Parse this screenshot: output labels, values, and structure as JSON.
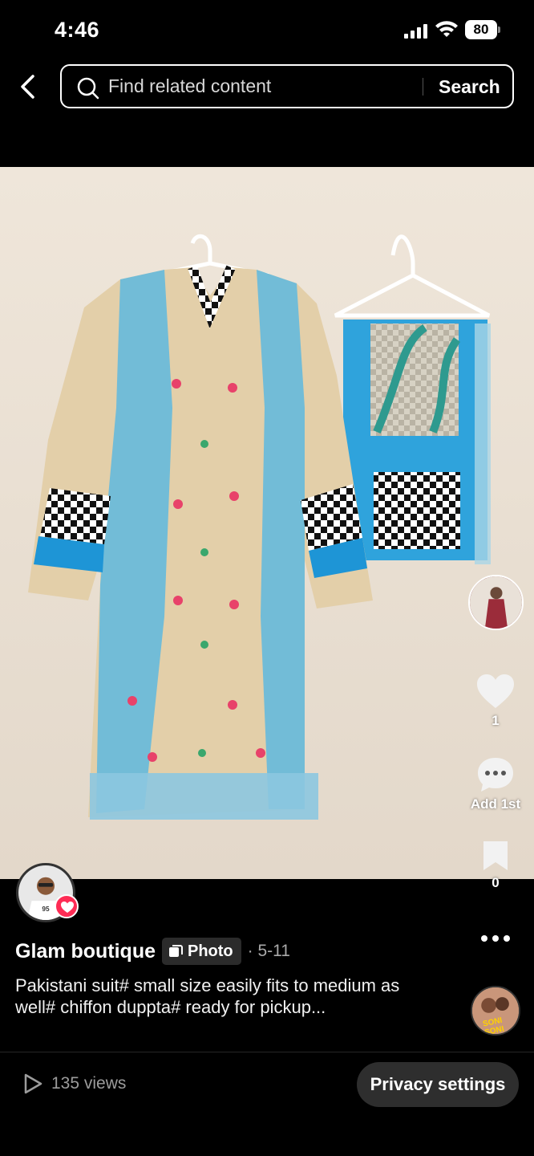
{
  "status_bar": {
    "time": "4:46",
    "battery": "80"
  },
  "search": {
    "placeholder": "Find related content",
    "button_label": "Search"
  },
  "post": {
    "author": "Glam boutique",
    "type_badge": "Photo",
    "date": "· 5-11",
    "caption": "Pakistani suit# small size easily fits to medium as well# chiffon duppta# ready for pickup...",
    "views": "135 views"
  },
  "rail": {
    "likes": "1",
    "comments": "Add 1st",
    "saves": "0"
  },
  "music": {
    "label": "SONI SONI"
  },
  "footer": {
    "privacy_label": "Privacy settings"
  },
  "colors": {
    "accent": "#fe2c55",
    "background": "#000000",
    "dupatta": "#2fa3dc",
    "kameez": "#e3cfa9"
  }
}
